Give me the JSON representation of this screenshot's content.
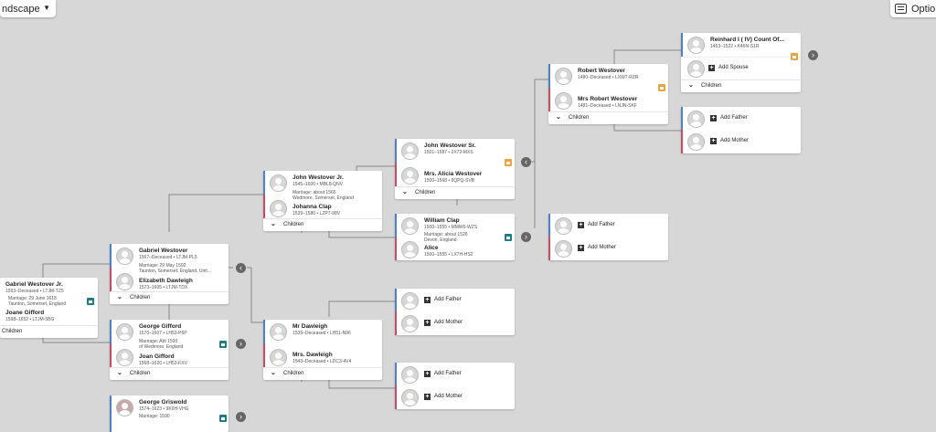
{
  "toolbar": {
    "view_label": "ndscape",
    "caret": "▼",
    "options_label": "Options"
  },
  "labels": {
    "children": "Children",
    "add_father": "Add Father",
    "add_mother": "Add Mother",
    "add_spouse": "Add Spouse",
    "plus": "+",
    "chev": "⌄",
    "left_arrow": "‹",
    "right_arrow": "›"
  },
  "couples": [
    {
      "id": "c0",
      "husband": {
        "name": "Gabriel Westover Jr.",
        "dates": "1593–Deceased  •  LTJM-TZ5"
      },
      "marriage": "Marriage: 29 June 1618\nTaunton, Somerset, England",
      "wife": {
        "name": "Joane Gifford",
        "dates": "1598–1652  •  LTJM-5BG"
      }
    },
    {
      "id": "c1",
      "husband": {
        "name": "Gabriel Westover",
        "dates": "1567–Deceased  •  LTJM-PL5"
      },
      "marriage": "Marriage: 29 May 1592\nTaunton, Somerset, England, Unit...",
      "wife": {
        "name": "Elizabeth Dawleigh",
        "dates": "1573–1605  •  LTJM-TDX"
      }
    },
    {
      "id": "c2",
      "husband": {
        "name": "George Gifford",
        "dates": "1570–1607  •  LH53-P6P"
      },
      "marriage": "Marriage: Abt 1590\nof Wedmore, England",
      "wife": {
        "name": "Joan Gifford",
        "dates": "1568–1620  •  LH53-FXV"
      }
    },
    {
      "id": "c3",
      "husband": {
        "name": "George Griswold",
        "dates": "1574–1623  •  9K6H-VHG"
      },
      "marriage": "Marriage: 1590",
      "wife": {
        "name": "",
        "dates": ""
      }
    },
    {
      "id": "c4",
      "husband": {
        "name": "John Westover Jr.",
        "dates": "1545–1600  •  MBL8-QNV"
      },
      "marriage": "Marriage: about 1565\nWedmore, Somerset, England",
      "wife": {
        "name": "Johanna Clap",
        "dates": "1539–1580  •  LZP7-98V"
      }
    },
    {
      "id": "c5",
      "husband": {
        "name": "Mr Dawleigh",
        "dates": "1539–Deceased  •  LH51-N96"
      },
      "marriage": "",
      "wife": {
        "name": "Mrs. Dawleigh",
        "dates": "1543–Deceased  •  LDC3-4V4"
      }
    },
    {
      "id": "c6",
      "husband": {
        "name": "John Westover Sr.",
        "dates": "1501–1587  •  2X72-MXS"
      },
      "marriage": "",
      "wife": {
        "name": "Mrs. Alicia Westover",
        "dates": "1500–1568  •  9QPQ-SVB"
      }
    },
    {
      "id": "c7",
      "husband": {
        "name": "William Clap",
        "dates": "1500–1555  •  MMW6-WZS"
      },
      "marriage": "Marriage: about 1526\nDevon, England",
      "wife": {
        "name": "Alice",
        "dates": "1500–1555  •  LX7H-HS2"
      }
    },
    {
      "id": "c8",
      "husband": {
        "name": "Robert Westover",
        "dates": "1480–Deceased  •  LXW7-RZR"
      },
      "marriage": "",
      "wife": {
        "name": "Mrs Robert Westover",
        "dates": "1481–Deceased  •  LNJN-SKF"
      }
    },
    {
      "id": "c9",
      "husband": {
        "name": "Reinhard I ( IV) Count Of...",
        "dates": "1453–1522  •  K46N-S1R"
      },
      "marriage": "",
      "wife": {
        "name": "",
        "dates": ""
      }
    }
  ]
}
